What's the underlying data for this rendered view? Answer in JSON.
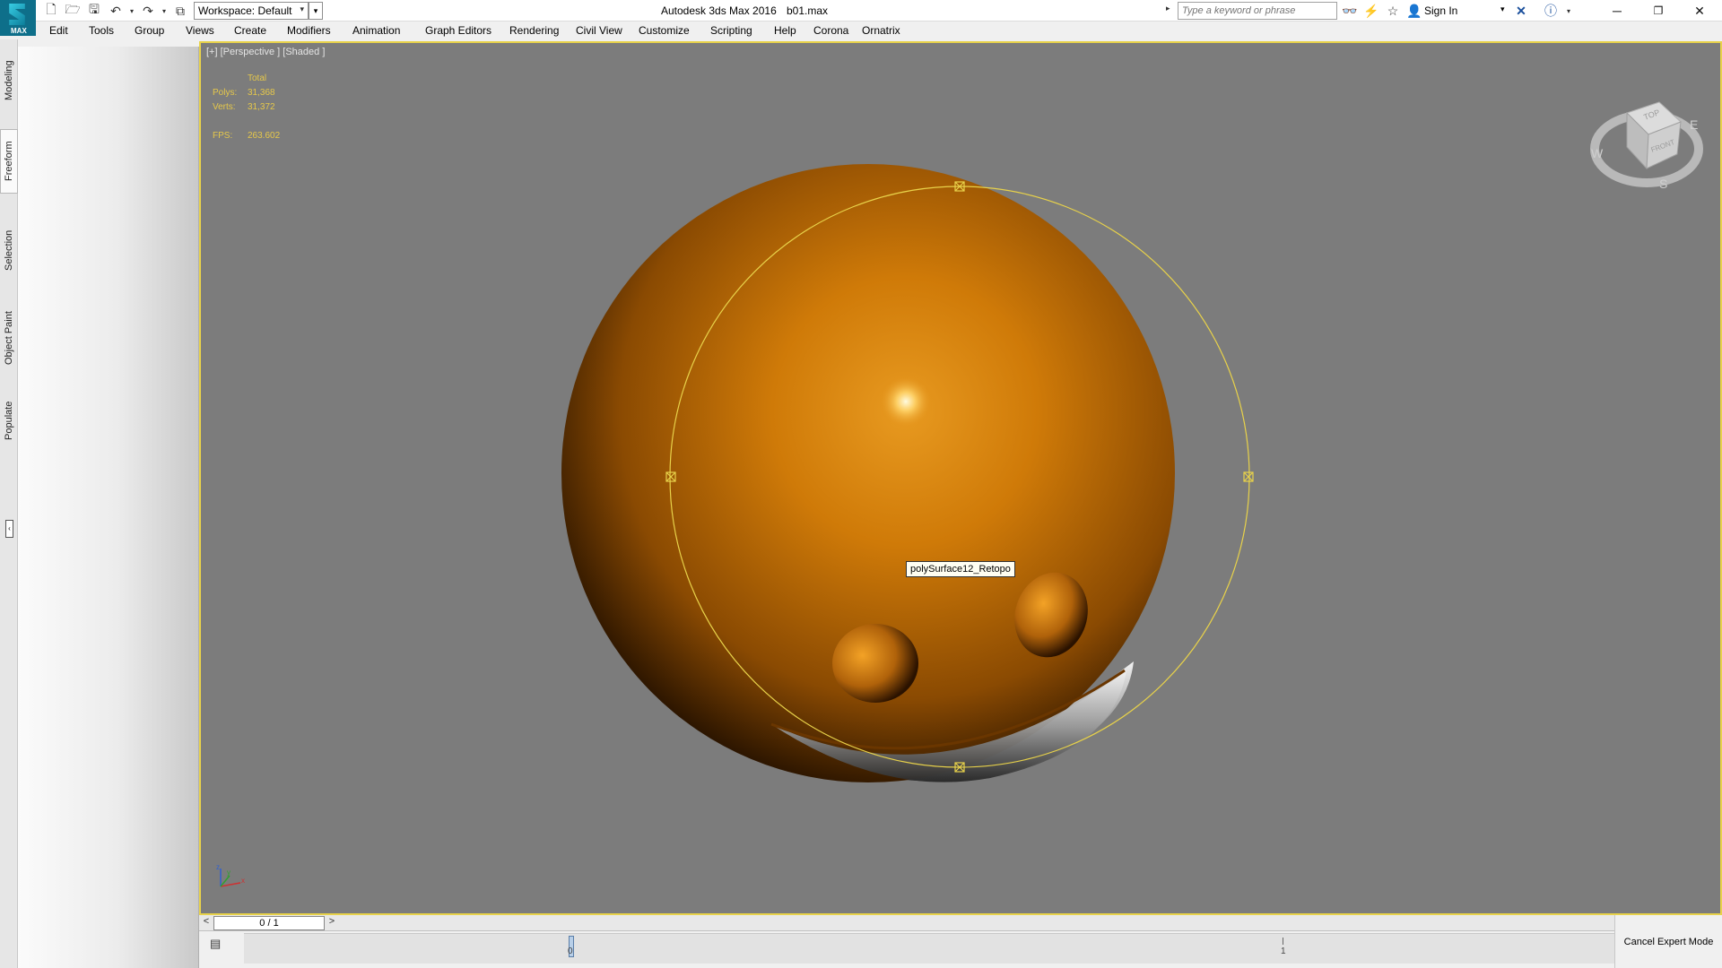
{
  "app": {
    "title": "Autodesk 3ds Max 2016",
    "file": "b01.max",
    "logo_text": "MAX"
  },
  "quick_access": {
    "workspace_label": "Workspace: Default"
  },
  "search": {
    "placeholder": "Type a keyword or phrase"
  },
  "account": {
    "sign_in_label": "Sign In"
  },
  "menu": [
    "Edit",
    "Tools",
    "Group",
    "Views",
    "Create",
    "Modifiers",
    "Animation",
    "Graph Editors",
    "Rendering",
    "Civil View",
    "Customize",
    "Scripting",
    "Help",
    "Corona",
    "Ornatrix"
  ],
  "ribbon_tabs": [
    "Modeling",
    "Freeform",
    "Selection",
    "Object Paint",
    "Populate"
  ],
  "active_ribbon_tab": "Freeform",
  "viewport": {
    "label": "[+] [Perspective ] [Shaded ]",
    "stats_header": "Total",
    "polys_label": "Polys:",
    "polys_value": "31,368",
    "verts_label": "Verts:",
    "verts_value": "31,372",
    "fps_label": "FPS:",
    "fps_value": "263.602",
    "object_name": "polySurface12_Retopo",
    "object_color": "#cf7a08",
    "selection_color": "#e8d24a"
  },
  "viewcube": {
    "top_label": "TOP",
    "front_label": "FRONT",
    "compass_w": "W",
    "compass_e": "E",
    "compass_s": "S"
  },
  "axis": {
    "x": "x",
    "y": "y",
    "z": "z"
  },
  "timeline": {
    "frame_display": "0 / 1",
    "marker_0": "0",
    "marker_1": "1"
  },
  "status": {
    "cancel_expert_label": "Cancel Expert Mode"
  }
}
